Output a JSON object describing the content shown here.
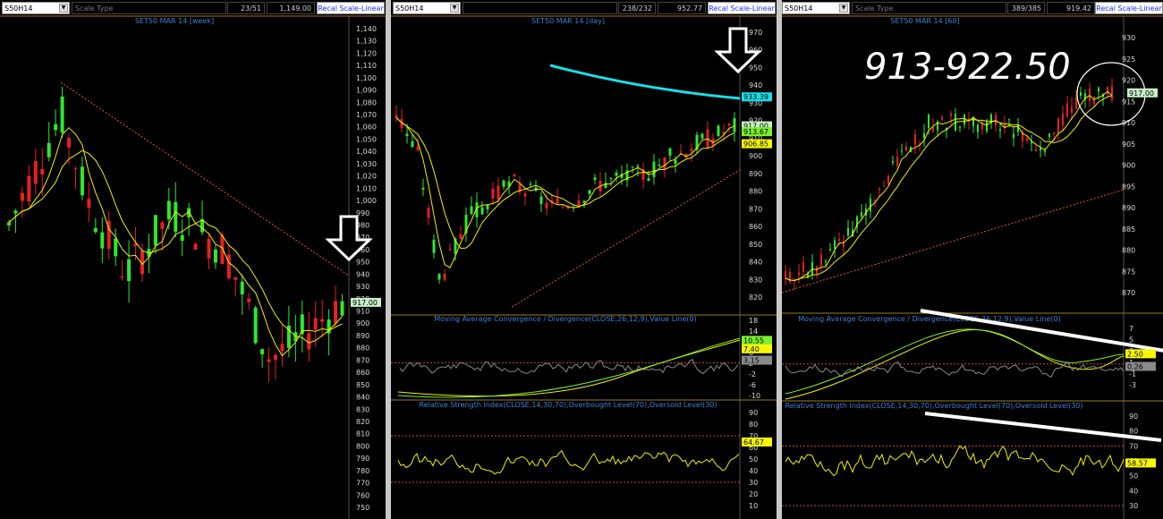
{
  "panels": [
    {
      "symbol": "S50H14",
      "scale_type": "Scale Type",
      "bar_count": "23/51",
      "value": "1,149.00",
      "recal": "Recal Scale-Linear",
      "main": {
        "title": "SET50 MAR 14  [week]",
        "ticks": [
          "1,140",
          "1,130",
          "1,120",
          "1,110",
          "1,100",
          "1,090",
          "1,080",
          "1,070",
          "1,060",
          "1,050",
          "1,040",
          "1,030",
          "1,020",
          "1,010",
          "1,000",
          "990",
          "980",
          "970",
          "960",
          "950",
          "940",
          "930",
          "920",
          "910",
          "900",
          "890",
          "880",
          "870",
          "860",
          "850",
          "840",
          "830",
          "820",
          "810",
          "800",
          "790",
          "780",
          "770",
          "760",
          "750"
        ],
        "labels": [
          {
            "text": "917.00",
            "value": 917,
            "color": "#c8f0c8"
          }
        ]
      }
    },
    {
      "symbol": "S50H14",
      "scale_type": "",
      "bar_count": "238/232",
      "value": "952.77",
      "recal": "Recal Scale-Linear",
      "main": {
        "title": "SET50 MAR 14  [day]",
        "ticks": [
          "970",
          "960",
          "950",
          "940",
          "930",
          "920",
          "910",
          "900",
          "890",
          "880",
          "870",
          "860",
          "850",
          "840",
          "830",
          "820"
        ],
        "labels": [
          {
            "text": "933.39",
            "value": 933.39,
            "color": "#19e0e8"
          },
          {
            "text": "917.00",
            "value": 917,
            "color": "#c8f0c8"
          },
          {
            "text": "913.67",
            "value": 913.67,
            "color": "#7cf02a"
          },
          {
            "text": "906.85",
            "value": 906.85,
            "color": "#f8f800"
          }
        ]
      },
      "macd": {
        "title": "Moving Average Convergence / Divergence(CLOSE,26,12,9),Value Line(0)",
        "ticks": [
          "18",
          "14",
          "10",
          "6",
          "2",
          "-2",
          "-6",
          "-10"
        ],
        "labels": [
          {
            "text": "10.55",
            "value": 10.55,
            "color": "#7cf02a"
          },
          {
            "text": "7.40",
            "value": 7.4,
            "color": "#f8f800"
          },
          {
            "text": "3.15",
            "value": 3.15,
            "color": "#8a8a8a"
          }
        ]
      },
      "rsi": {
        "title": "Relative Strength Index(CLOSE,14,30,70),Overbought Level(70),Oversold Level(30)",
        "ticks": [
          "90",
          "80",
          "70",
          "60",
          "50",
          "40",
          "30",
          "20",
          "10"
        ],
        "labels": [
          {
            "text": "64.67",
            "value": 64.67,
            "color": "#f8f800"
          }
        ]
      }
    },
    {
      "symbol": "S50H14",
      "scale_type": "Scale Type",
      "bar_count": "389/385",
      "value": "919.42",
      "recal": "Recal Scale-Linear",
      "main": {
        "title": "SET50 MAR 14  [60]",
        "ticks": [
          "930",
          "925",
          "920",
          "915",
          "910",
          "905",
          "900",
          "895",
          "890",
          "885",
          "880",
          "875",
          "870"
        ],
        "labels": [
          {
            "text": "917.00",
            "value": 917,
            "color": "#c8f0c8"
          }
        ]
      },
      "macd": {
        "title": "Moving Average Convergence / Divergence(CLOSE,26,12,9),Value Line(0)",
        "ticks": [
          "7",
          "5",
          "3",
          "1",
          "-1",
          "-3"
        ],
        "labels": [
          {
            "text": "2.50",
            "value": 2.5,
            "color": "#f8f800"
          },
          {
            "text": "0.26",
            "value": 0.26,
            "color": "#8a8a8a"
          }
        ]
      },
      "rsi": {
        "title": "Relative Strength Index(CLOSE,14,30,70),Overbought Level(70),Oversold Level(30)",
        "ticks": [
          "90",
          "80",
          "70",
          "60",
          "50",
          "40",
          "30"
        ],
        "labels": [
          {
            "text": "58.57",
            "value": 58.57,
            "color": "#f8f800"
          }
        ]
      }
    }
  ],
  "annotation_text": "913-922.50",
  "colors": {
    "up": "#2ee82e",
    "down": "#e82020",
    "ma": "#f0f000",
    "trend": "#e06020",
    "cyan": "#19e0e8",
    "level": "#c84848"
  },
  "chart_data": [
    {
      "type": "candlestick",
      "title": "SET50 MAR 14  [week]",
      "ylim": [
        750,
        1140
      ],
      "close_trend": [
        {
          "x": 0,
          "y": 980
        },
        {
          "x": 8,
          "y": 1070
        },
        {
          "x": 12,
          "y": 1000
        },
        {
          "x": 18,
          "y": 940
        },
        {
          "x": 25,
          "y": 990
        },
        {
          "x": 33,
          "y": 960
        },
        {
          "x": 40,
          "y": 870
        },
        {
          "x": 45,
          "y": 890
        },
        {
          "x": 51,
          "y": 917
        }
      ],
      "last": 917
    },
    {
      "type": "candlestick",
      "title": "SET50 MAR 14  [day]",
      "ylim": [
        815,
        975
      ],
      "close_trend": [
        {
          "x": 0,
          "y": 925
        },
        {
          "x": 15,
          "y": 900
        },
        {
          "x": 30,
          "y": 830
        },
        {
          "x": 50,
          "y": 865
        },
        {
          "x": 80,
          "y": 885
        },
        {
          "x": 110,
          "y": 870
        },
        {
          "x": 140,
          "y": 885
        },
        {
          "x": 170,
          "y": 890
        },
        {
          "x": 200,
          "y": 905
        },
        {
          "x": 232,
          "y": 917
        }
      ],
      "last": 917,
      "ma_values": [
        933.39,
        913.67,
        906.85
      ]
    },
    {
      "type": "candlestick",
      "title": "SET50 MAR 14  [60]",
      "ylim": [
        866,
        932
      ],
      "close_trend": [
        {
          "x": 0,
          "y": 873
        },
        {
          "x": 40,
          "y": 877
        },
        {
          "x": 80,
          "y": 885
        },
        {
          "x": 130,
          "y": 900
        },
        {
          "x": 170,
          "y": 910
        },
        {
          "x": 220,
          "y": 910
        },
        {
          "x": 260,
          "y": 910
        },
        {
          "x": 300,
          "y": 903
        },
        {
          "x": 340,
          "y": 915
        },
        {
          "x": 385,
          "y": 917
        }
      ],
      "last": 917
    }
  ]
}
